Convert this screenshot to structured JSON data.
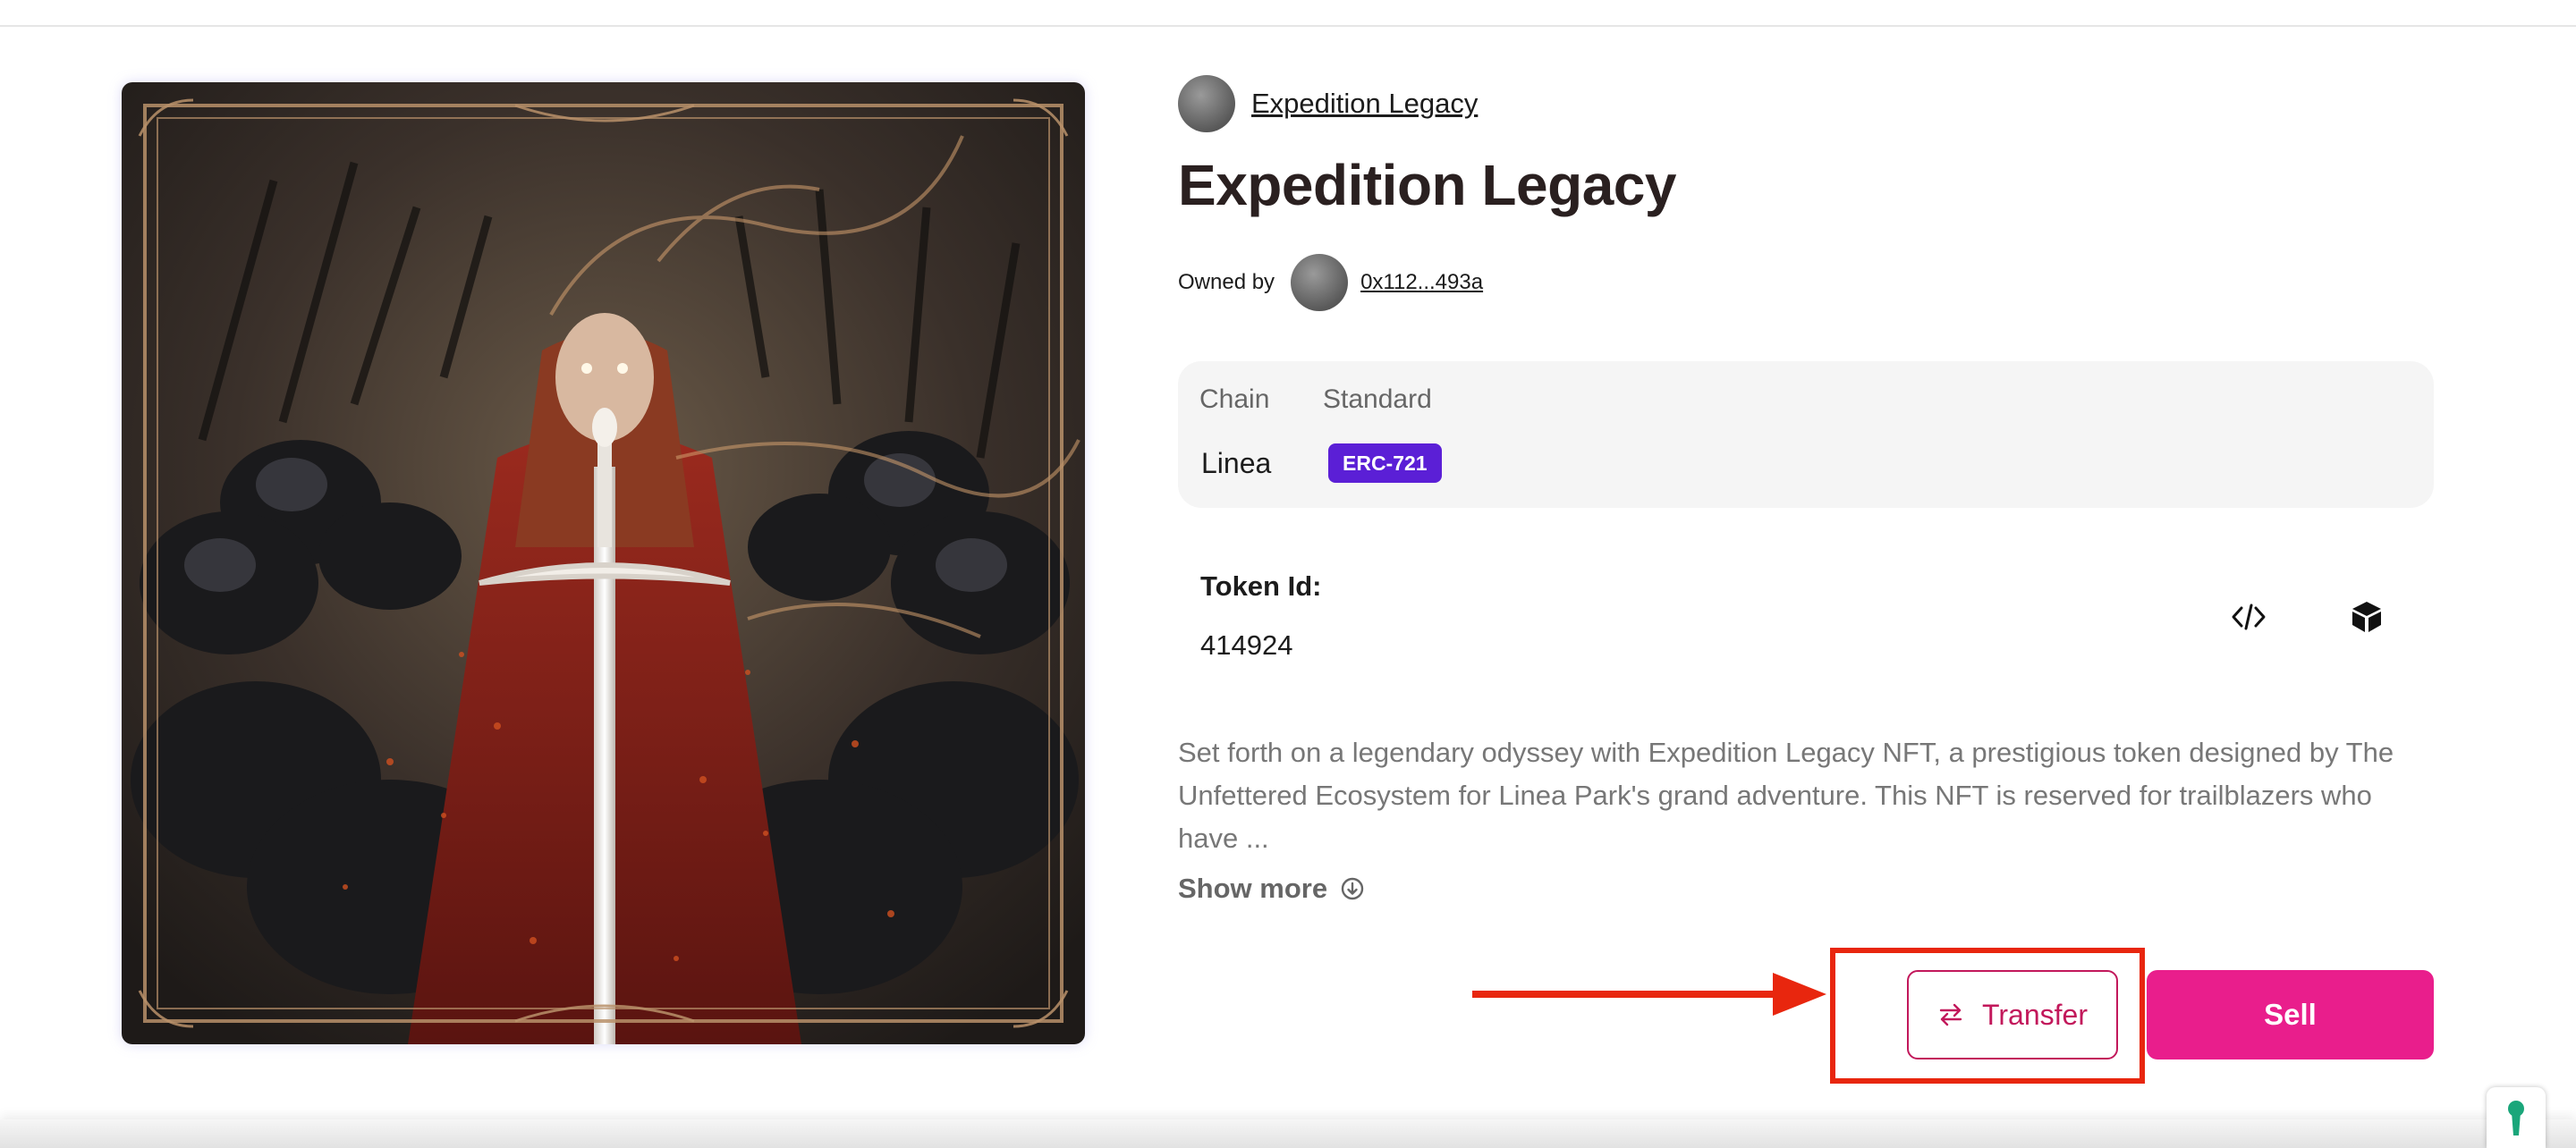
{
  "collection": {
    "name": "Expedition Legacy"
  },
  "nft": {
    "title": "Expedition Legacy",
    "owned_by_label": "Owned by",
    "owner_address": "0x112...493a"
  },
  "details": {
    "chain_label": "Chain",
    "chain_value": "Linea",
    "standard_label": "Standard",
    "standard_value": "ERC-721"
  },
  "token": {
    "label": "Token Id:",
    "value": "414924"
  },
  "icons": {
    "code": "code-icon",
    "cube": "cube-icon",
    "show_more": "arrow-circle-down-icon",
    "transfer": "swap-arrows-icon"
  },
  "description": "Set forth on a legendary odyssey with Expedition Legacy NFT, a prestigious token designed by The Unfettered Ecosystem for Linea Park's grand adventure. This NFT is reserved for trailblazers who have ...",
  "show_more_label": "Show more",
  "actions": {
    "transfer_label": "Transfer",
    "sell_label": "Sell"
  },
  "colors": {
    "accent_pink": "#e91e8c",
    "transfer_border": "#c2185b",
    "badge_purple": "#5b1fd6",
    "annotation_red": "#e8260e"
  }
}
